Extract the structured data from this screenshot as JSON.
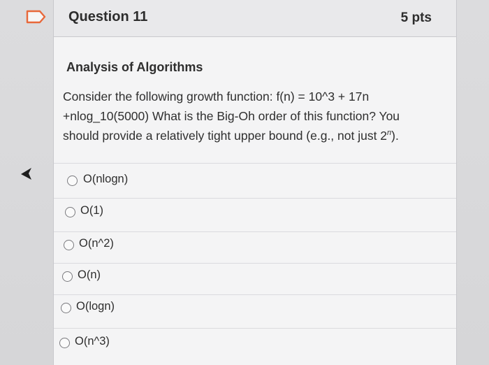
{
  "question": {
    "title": "Question 11",
    "points": "5 pts",
    "section": "Analysis of Algorithms",
    "text_before": "Consider the following growth function: f(n) = 10^3 + 17n +nlog_10(5000) What is the Big-Oh order of this function? You should provide a relatively tight upper bound (e.g., not just 2",
    "text_sup": "n",
    "text_after": ")."
  },
  "answers": [
    {
      "label": "O(nlogn)"
    },
    {
      "label": "O(1)"
    },
    {
      "label": "O(n^2)"
    },
    {
      "label": "O(n)"
    },
    {
      "label": "O(logn)"
    },
    {
      "label": "O(n^3)"
    }
  ],
  "icons": {
    "flag": "flag-icon",
    "cursor": "mouse-cursor-icon",
    "radio": "radio-button-icon"
  },
  "colors": {
    "page_bg": "#d9d9db",
    "card_bg": "#f4f4f5",
    "header_bg": "#e9e9eb",
    "flag_accent": "#e8683a",
    "text": "#2b2b2b"
  }
}
